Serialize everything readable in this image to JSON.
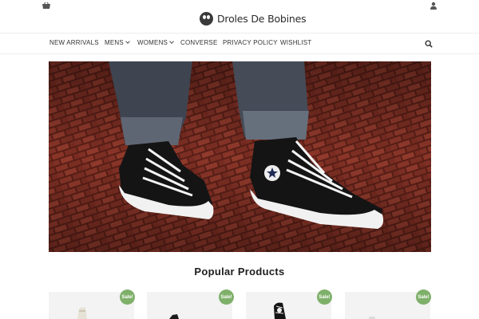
{
  "site": {
    "logo_text": "Droles De Bobines"
  },
  "header": {
    "cart_icon": "shopping-basket-icon",
    "user_icon": "user-icon"
  },
  "nav": {
    "items": [
      {
        "label": "NEW ARRIVALS",
        "has_dropdown": false
      },
      {
        "label": "MENS",
        "has_dropdown": true
      },
      {
        "label": "WOMENS",
        "has_dropdown": true
      },
      {
        "label": "CONVERSE",
        "has_dropdown": false
      },
      {
        "label": "PRIVACY POLICY",
        "has_dropdown": false
      },
      {
        "label": "WISHLIST",
        "has_dropdown": false
      }
    ],
    "search_icon": "search-icon"
  },
  "hero": {
    "image": "sneakers-on-brick-pavement"
  },
  "popular": {
    "title": "Popular Products",
    "products": [
      {
        "badge": "Sale!"
      },
      {
        "badge": "Sale!"
      },
      {
        "badge": "Sale!"
      },
      {
        "badge": "Sale!"
      }
    ]
  },
  "colors": {
    "sale_badge": "#7fb06a",
    "hero_brick": "#7a2d22"
  }
}
